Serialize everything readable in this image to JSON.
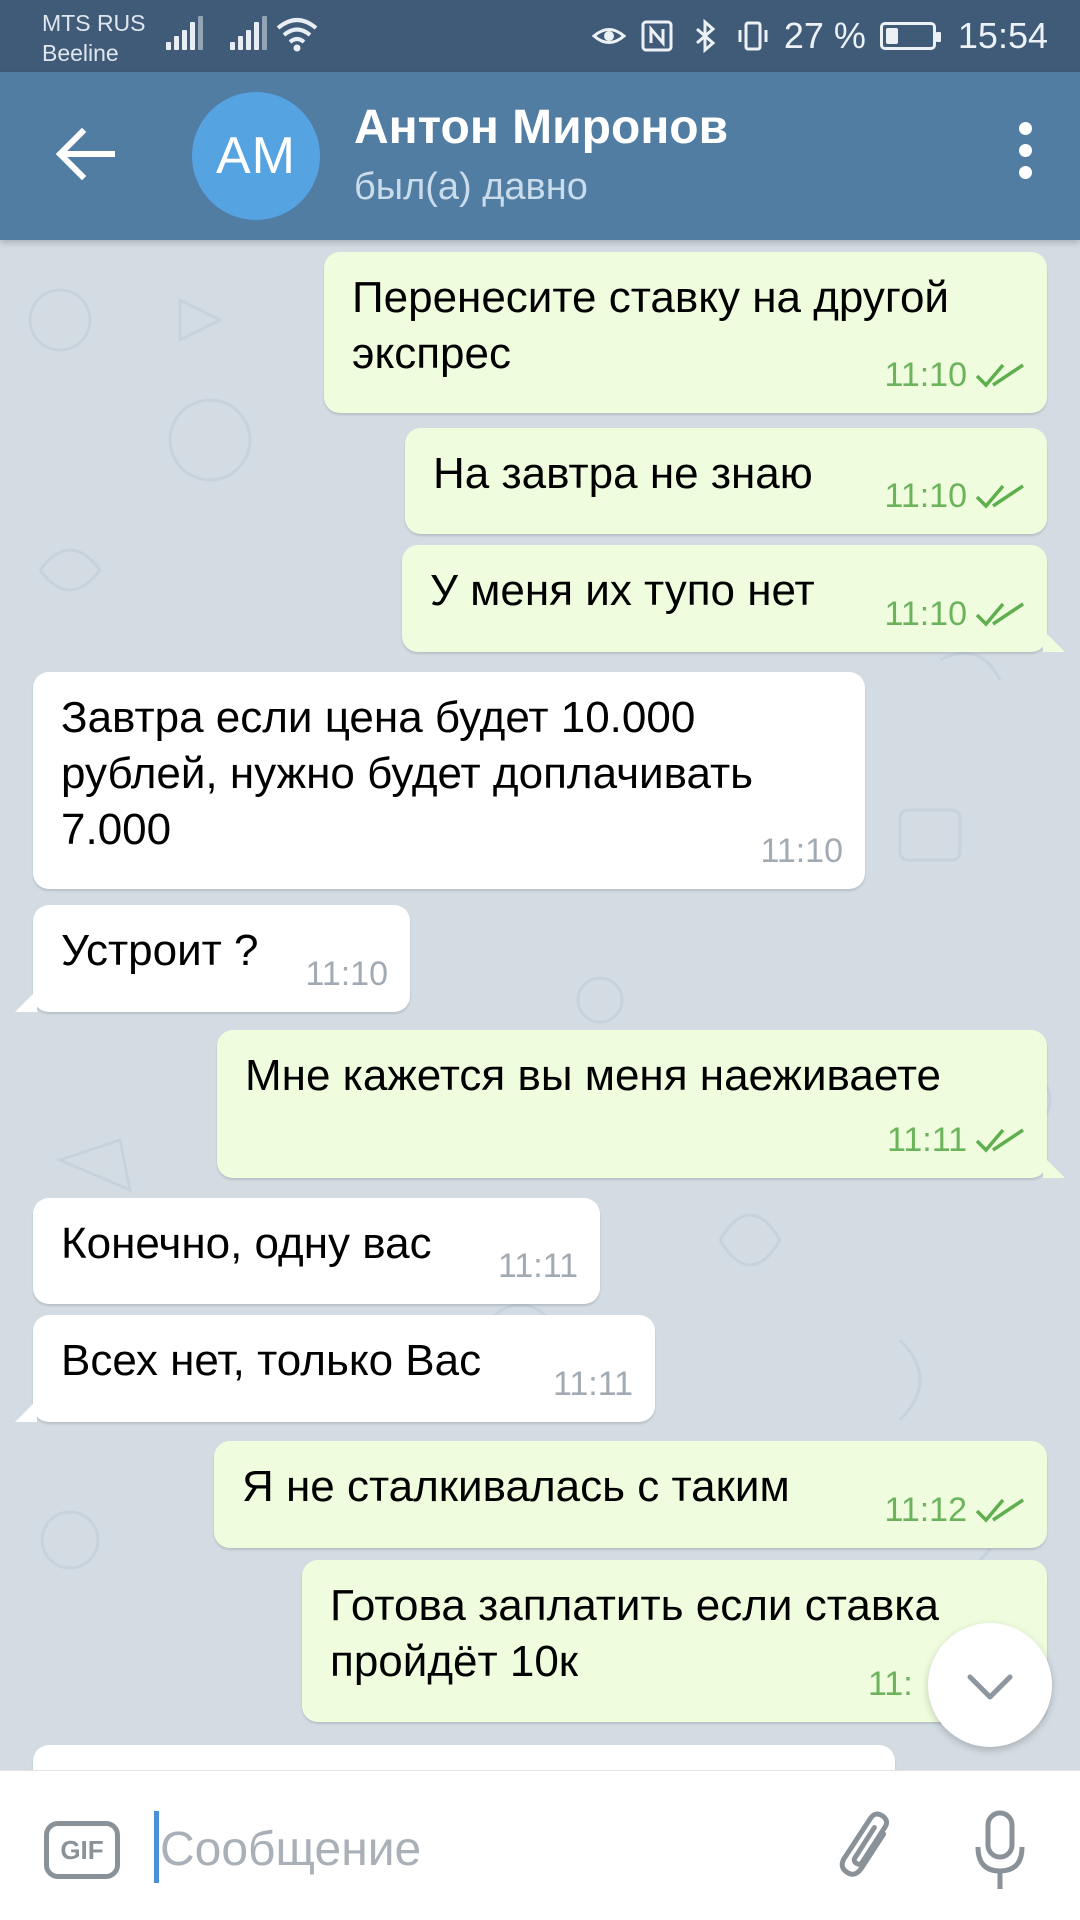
{
  "status_bar": {
    "carrier_1": "MTS RUS",
    "carrier_2": "Beeline",
    "battery_percent": "27 %",
    "time": "15:54"
  },
  "header": {
    "avatar_initials": "АМ",
    "title": "Антон Миронов",
    "subtitle": "был(а) давно"
  },
  "messages": [
    {
      "direction": "out",
      "text_lines": [
        "Перенесите ставку на другой",
        "экспрес"
      ],
      "time": "11:10",
      "read": true
    },
    {
      "direction": "out",
      "text_lines": [
        "На завтра не знаю"
      ],
      "time": "11:10",
      "read": true
    },
    {
      "direction": "out",
      "text_lines": [
        "У меня их тупо нет"
      ],
      "time": "11:10",
      "read": true
    },
    {
      "direction": "in",
      "text_lines": [
        "Завтра если цена будет 10.000",
        "рублей, нужно будет доплачивать",
        "7.000"
      ],
      "time": "11:10"
    },
    {
      "direction": "in",
      "text_lines": [
        "Устроит ?"
      ],
      "time": "11:10"
    },
    {
      "direction": "out",
      "text_lines": [
        "Мне кажется вы меня наеживаете"
      ],
      "time": "11:11",
      "read": true
    },
    {
      "direction": "in",
      "text_lines": [
        "Конечно, одну вас"
      ],
      "time": "11:11"
    },
    {
      "direction": "in",
      "text_lines": [
        "Всех нет, только Вас"
      ],
      "time": "11:11"
    },
    {
      "direction": "out",
      "text_lines": [
        "Я не сталкивалась с таким"
      ],
      "time": "11:12",
      "read": true
    },
    {
      "direction": "out",
      "text_lines": [
        "Готова заплатить если ставка",
        "пройдёт 10к"
      ],
      "time": "11:",
      "read": true
    }
  ],
  "input": {
    "placeholder": "Сообщение",
    "value": "",
    "gif_label": "GIF"
  },
  "colors": {
    "header_bg": "#527da3",
    "status_bar_bg": "#3f5b78",
    "avatar_bg": "#56a3e2",
    "outgoing_bubble": "#effdde",
    "incoming_bubble": "#ffffff",
    "chat_bg": "#d3dce3",
    "read_check": "#6cb35c"
  },
  "icons": {
    "back": "arrow-left-icon",
    "more": "more-vertical-icon",
    "read_receipt": "double-check-icon",
    "scroll_down": "chevron-down-icon",
    "attach": "paperclip-icon",
    "voice": "microphone-icon",
    "gif": "gif-icon"
  }
}
